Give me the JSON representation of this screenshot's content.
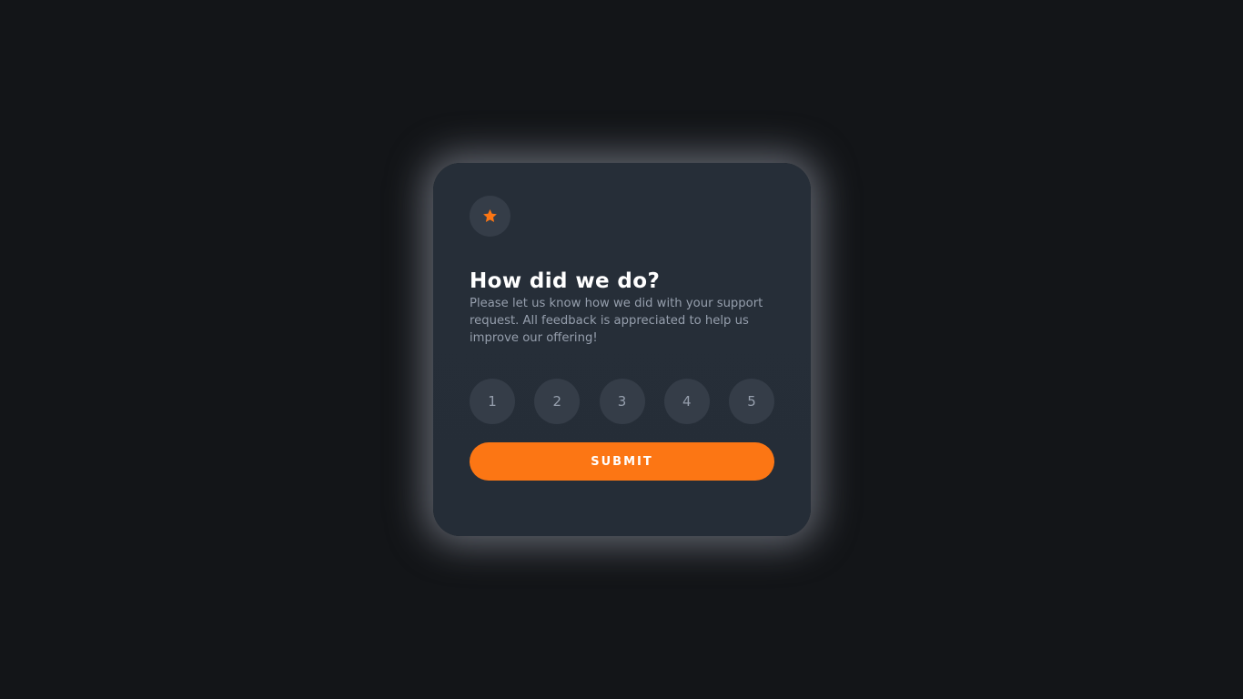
{
  "card": {
    "icon": "star-icon",
    "title": "How did we do?",
    "description": "Please let us know how we did with your support request. All feedback is appreciated to help us improve our offering!",
    "ratings": [
      "1",
      "2",
      "3",
      "4",
      "5"
    ],
    "submit_label": "SUBMIT"
  },
  "colors": {
    "page_background": "#131518",
    "card_background": "#262e38",
    "accent": "#fc7614",
    "circle_background": "#353d48",
    "muted_text": "#969fad",
    "title_text": "#ffffff"
  }
}
